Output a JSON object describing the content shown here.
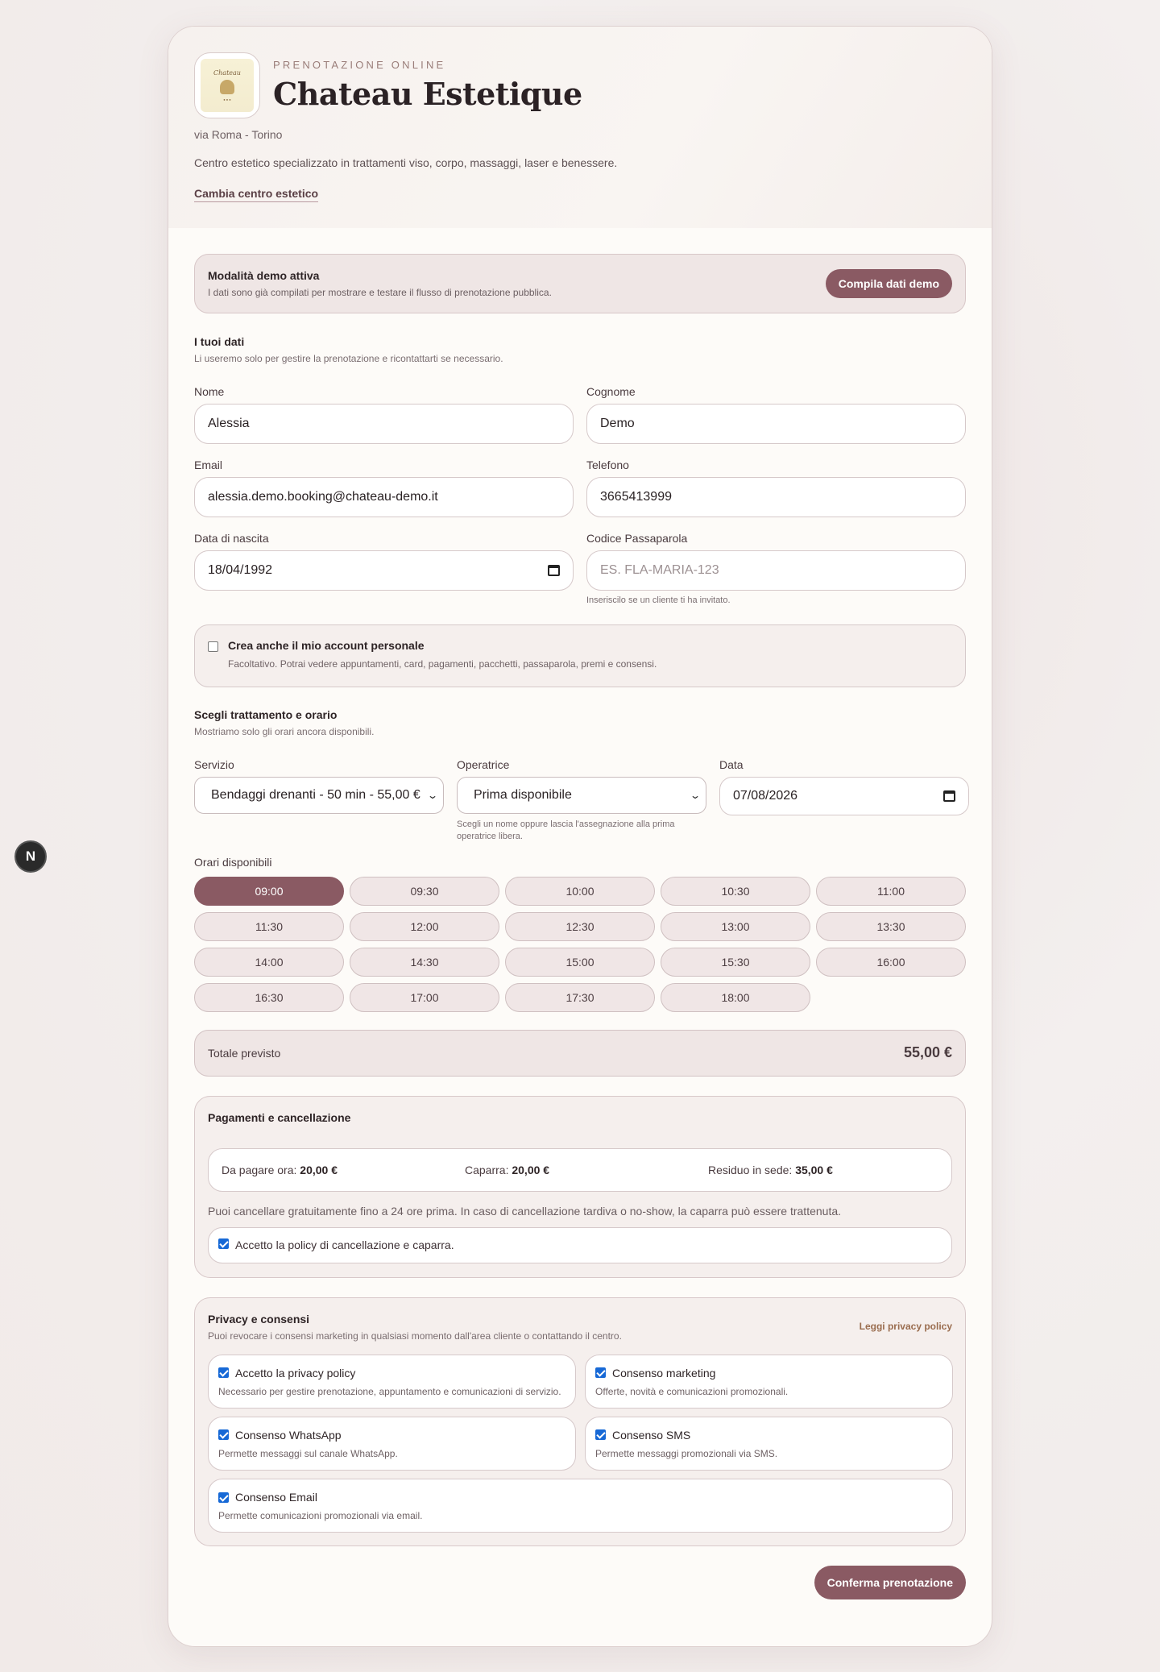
{
  "hero": {
    "kicker": "PRENOTAZIONE ONLINE",
    "brand": "Chateau Estetique",
    "address": "via Roma - Torino",
    "description": "Centro estetico specializzato in trattamenti viso, corpo, massaggi, laser e benessere.",
    "change_link": "Cambia centro estetico",
    "logo_text": "Chateau Estetique"
  },
  "demo": {
    "title": "Modalità demo attiva",
    "subtitle": "I dati sono già compilati per mostrare e testare il flusso di prenotazione pubblica.",
    "button": "Compila dati demo"
  },
  "personal": {
    "title": "I tuoi dati",
    "subtitle": "Li useremo solo per gestire la prenotazione e ricontattarti se necessario.",
    "nome_label": "Nome",
    "nome_value": "Alessia",
    "cognome_label": "Cognome",
    "cognome_value": "Demo",
    "email_label": "Email",
    "email_value": "alessia.demo.booking@chateau-demo.it",
    "telefono_label": "Telefono",
    "telefono_value": "3665413999",
    "nascita_label": "Data di nascita",
    "nascita_value": "18/04/1992",
    "codice_label": "Codice Passaparola",
    "codice_placeholder": "ES. FLA-MARIA-123",
    "codice_hint": "Inseriscilo se un cliente ti ha invitato."
  },
  "account": {
    "title": "Crea anche il mio account personale",
    "subtitle": "Facoltativo. Potrai vedere appuntamenti, card, pagamenti, pacchetti, passaparola, premi e consensi.",
    "checked": false
  },
  "booking": {
    "title": "Scegli trattamento e orario",
    "subtitle": "Mostriamo solo gli orari ancora disponibili.",
    "servizio_label": "Servizio",
    "servizio_value": "Bendaggi drenanti - 50 min - 55,00 €",
    "operatrice_label": "Operatrice",
    "operatrice_value": "Prima disponibile",
    "operatrice_hint": "Scegli un nome oppure lascia l'assegnazione alla prima operatrice libera.",
    "data_label": "Data",
    "data_value": "07/08/2026",
    "slots_label": "Orari disponibili",
    "selected_slot": "09:00",
    "slots": [
      "09:00",
      "09:30",
      "10:00",
      "10:30",
      "11:00",
      "11:30",
      "12:00",
      "12:30",
      "13:00",
      "13:30",
      "14:00",
      "14:30",
      "15:00",
      "15:30",
      "16:00",
      "16:30",
      "17:00",
      "17:30",
      "18:00"
    ]
  },
  "total": {
    "label": "Totale previsto",
    "value": "55,00 €"
  },
  "payments": {
    "title": "Pagamenti e cancellazione",
    "now_label": "Da pagare ora:",
    "now_value": "20,00 €",
    "deposit_label": "Caparra:",
    "deposit_value": "20,00 €",
    "rest_label": "Residuo in sede:",
    "rest_value": "35,00 €",
    "policy_text": "Puoi cancellare gratuitamente fino a 24 ore prima. In caso di cancellazione tardiva o no-show, la caparra può essere trattenuta.",
    "accept_label": "Accetto la policy di cancellazione e caparra."
  },
  "privacy": {
    "title": "Privacy e consensi",
    "subtitle": "Puoi revocare i consensi marketing in qualsiasi momento dall'area cliente o contattando il centro.",
    "link": "Leggi privacy policy",
    "items": [
      {
        "title": "Accetto la privacy policy",
        "sub": "Necessario per gestire prenotazione, appuntamento e comunicazioni di servizio."
      },
      {
        "title": "Consenso marketing",
        "sub": "Offerte, novità e comunicazioni promozionali."
      },
      {
        "title": "Consenso WhatsApp",
        "sub": "Permette messaggi sul canale WhatsApp."
      },
      {
        "title": "Consenso SMS",
        "sub": "Permette messaggi promozionali via SMS."
      },
      {
        "title": "Consenso Email",
        "sub": "Permette comunicazioni promozionali via email."
      }
    ]
  },
  "confirm_button": "Conferma prenotazione",
  "side_badge": "N",
  "colors": {
    "accent": "#8a5a63",
    "panel": "#efe6e5",
    "link": "#9a6d4f"
  }
}
